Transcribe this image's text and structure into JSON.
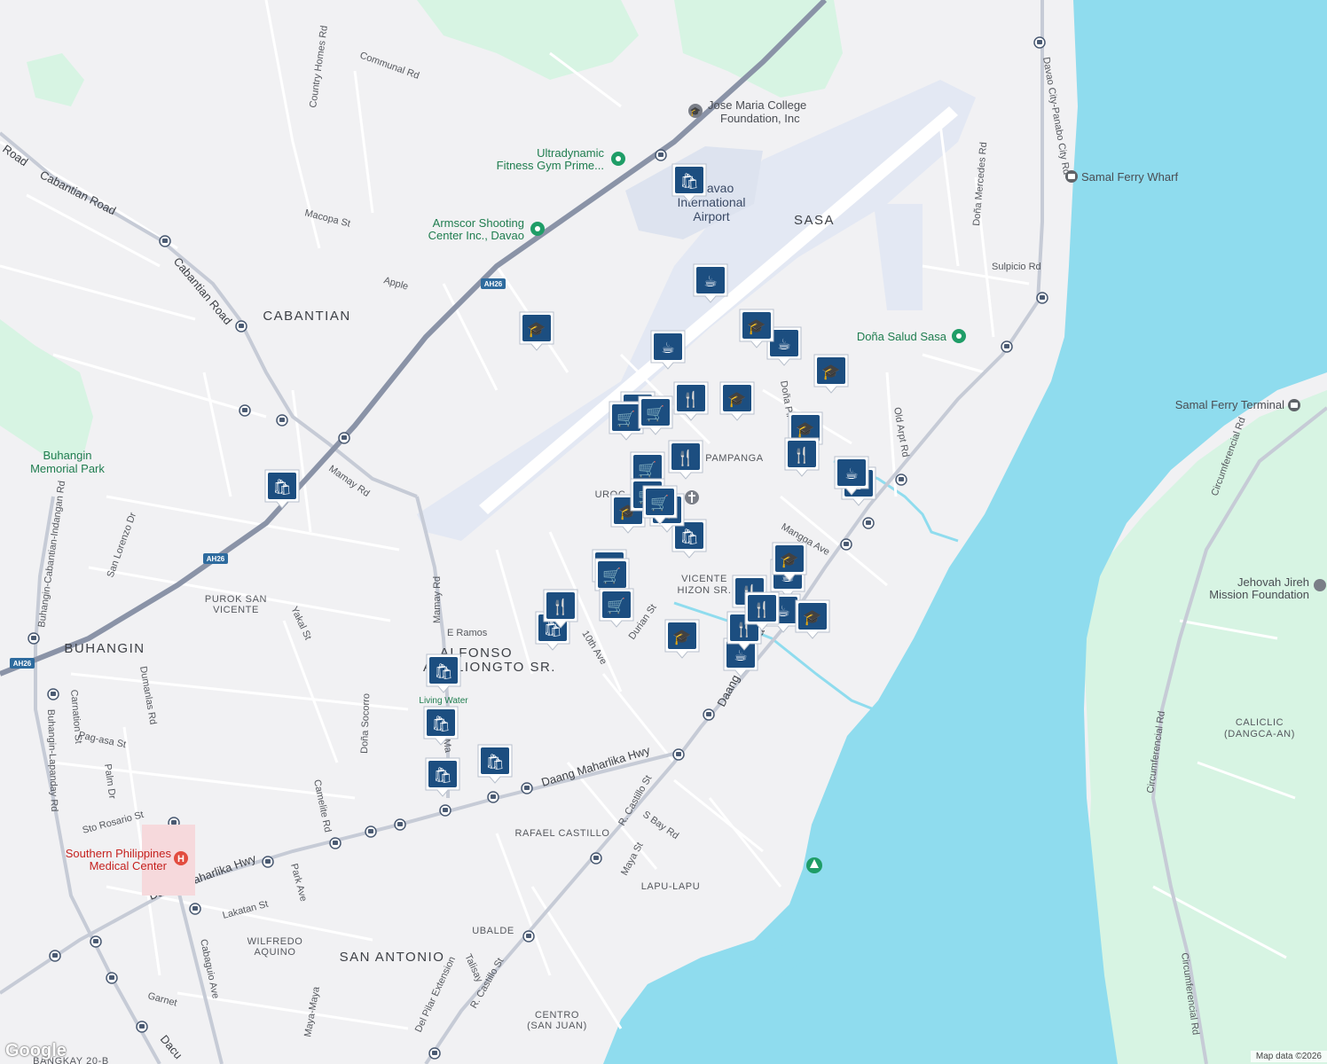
{
  "map": {
    "colors": {
      "land": "#f1f1f3",
      "water": "#8fdcee",
      "park": "#d7f4e3",
      "airport": "#e3e8f3",
      "road_minor": "#ffffff",
      "road_major": "#c6cbd6",
      "highway": "#8a93a7",
      "pin": "#1c4e80",
      "poi_green": "#1f7d4f",
      "poi_red": "#c5221f"
    },
    "areas": [
      {
        "text": "SASA"
      },
      {
        "text": "CABANTIAN"
      },
      {
        "text": "BUHANGIN"
      },
      {
        "text": "SAN ANTONIO"
      },
      {
        "text": "PAMPANGA"
      },
      {
        "text": "ALFONSO"
      },
      {
        "text": "ANGLIONGTO SR."
      }
    ],
    "small_areas": [
      {
        "text": "PUROK SAN"
      },
      {
        "text": "VICENTE"
      },
      {
        "text": "VICENTE"
      },
      {
        "text": "HIZON SR."
      },
      {
        "text": "RAFAEL CASTILLO"
      },
      {
        "text": "LAPU-LAPU"
      },
      {
        "text": "UBALDE"
      },
      {
        "text": "WILFREDO"
      },
      {
        "text": "AQUINO"
      },
      {
        "text": "CENTRO"
      },
      {
        "text": "(SAN JUAN)"
      },
      {
        "text": "CALICLIC"
      },
      {
        "text": "(DANGCA-AN)"
      },
      {
        "text": "UROC"
      },
      {
        "text": "BANGKAY 20-B"
      }
    ],
    "roads": [
      {
        "text": "Communal Rd"
      },
      {
        "text": "Country Homes Rd"
      },
      {
        "text": "Cabantian Road"
      },
      {
        "text": "Cabantian Road"
      },
      {
        "text": "Road"
      },
      {
        "text": "Macopa St"
      },
      {
        "text": "Apple"
      },
      {
        "text": "Mamay Rd"
      },
      {
        "text": "Mamay Rd"
      },
      {
        "text": "Buhangin-Cabantian-Indangan Rd"
      },
      {
        "text": "San Lorenzo Dr"
      },
      {
        "text": "Yakal St"
      },
      {
        "text": "E Ramos"
      },
      {
        "text": "10th Ave"
      },
      {
        "text": "Durian St"
      },
      {
        "text": "Mangga Ave"
      },
      {
        "text": "Doña Pil"
      },
      {
        "text": "Old Arpt Rd"
      },
      {
        "text": "Doña Mercedes Rd"
      },
      {
        "text": "Sulpicio Rd"
      },
      {
        "text": "Davao City-Panabo City Rd"
      },
      {
        "text": "Daang Maharlika Hwy"
      },
      {
        "text": "Daang Maharlika Hwy"
      },
      {
        "text": "Daang Maharlika"
      },
      {
        "text": "R. Castillo St"
      },
      {
        "text": "R. Castillo St"
      },
      {
        "text": "S Bay Rd"
      },
      {
        "text": "Maya St"
      },
      {
        "text": "Camelite Rd"
      },
      {
        "text": "Doña Socorro"
      },
      {
        "text": "Buhangin-Lapanday Rd"
      },
      {
        "text": "Carnation St"
      },
      {
        "text": "Dumanlas Rd"
      },
      {
        "text": "Pag-asa St"
      },
      {
        "text": "Palm Dr"
      },
      {
        "text": "Sto Rosario St"
      },
      {
        "text": "Park Ave"
      },
      {
        "text": "Lakatan St"
      },
      {
        "text": "Cabaguio Ave"
      },
      {
        "text": "Garnet"
      },
      {
        "text": "Maya-Maya"
      },
      {
        "text": "Talisay"
      },
      {
        "text": "Del Pilar Extension"
      },
      {
        "text": "Circumferencial Rd"
      },
      {
        "text": "Circumferencial Rd"
      },
      {
        "text": "Circumferencial Rd"
      },
      {
        "text": "Dacu"
      },
      {
        "text": "Ma"
      }
    ],
    "highway_shields": [
      {
        "text": "AH26"
      },
      {
        "text": "AH26"
      },
      {
        "text": "AH26"
      }
    ],
    "pois": [
      {
        "text": "Jose Maria College"
      },
      {
        "text": "Foundation, Inc"
      },
      {
        "text": "Ultradynamic"
      },
      {
        "text": "Fitness Gym Prime..."
      },
      {
        "text": "Armscor Shooting"
      },
      {
        "text": "Center Inc., Davao"
      },
      {
        "text": "Davao"
      },
      {
        "text": "International"
      },
      {
        "text": "Airport"
      },
      {
        "text": "Doña Salud Sasa"
      },
      {
        "text": "Samal Ferry Wharf"
      },
      {
        "text": "Samal Ferry Terminal"
      },
      {
        "text": "Buhangin"
      },
      {
        "text": "Memorial Park"
      },
      {
        "text": "Living Water"
      },
      {
        "text": "Southern Philippines"
      },
      {
        "text": "Medical Center"
      },
      {
        "text": "Jehovah Jireh"
      },
      {
        "text": "Mission Foundation"
      }
    ],
    "markers": [
      {
        "category": "shopping-bag",
        "icon": "bag-icon",
        "glyph": "🛍"
      },
      {
        "category": "cafe",
        "icon": "coffee-icon",
        "glyph": "☕"
      },
      {
        "category": "school",
        "icon": "graduation-cap-icon",
        "glyph": "🎓"
      },
      {
        "category": "restaurant",
        "icon": "fork-knife-icon",
        "glyph": "🍴"
      },
      {
        "category": "grocery",
        "icon": "shopping-cart-icon",
        "glyph": "🛒"
      }
    ]
  },
  "branding": {
    "logo": "Google",
    "attribution": "Map data ©2026"
  }
}
